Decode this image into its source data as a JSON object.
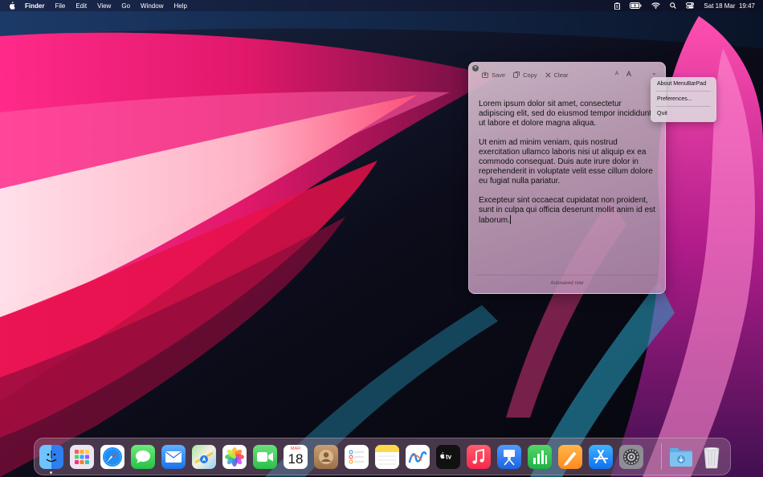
{
  "menubar": {
    "apple_icon": "apple-logo-icon",
    "app_name": "Finder",
    "menus": [
      "File",
      "Edit",
      "View",
      "Go",
      "Window",
      "Help"
    ],
    "status_icons": [
      "clipboard-icon",
      "battery-charging-icon",
      "wifi-icon",
      "spotlight-search-icon",
      "control-center-icon"
    ],
    "datetime": "Sat 18 Mar  19:47"
  },
  "note_window": {
    "toolbar": {
      "save_label": "Save",
      "copy_label": "Copy",
      "clear_label": "Clear",
      "font_small": "A",
      "font_large": "A",
      "menu_chevron": "⌄"
    },
    "paragraphs": [
      "Lorem ipsum dolor sit amet, consectetur adipiscing elit, sed do eiusmod tempor incididunt ut labore et dolore magna aliqua.",
      "Ut enim ad minim veniam, quis nostrud exercitation ullamco laboris nisi ut aliquip ex ea commodo consequat. Duis aute irure dolor in reprehenderit in voluptate velit esse cillum dolore eu fugiat nulla pariatur.",
      "Excepteur sint occaecat cupidatat non proident, sunt in culpa qui officia deserunt mollit anim id est laborum."
    ],
    "status": "Autosaved now"
  },
  "dropdown_menu": {
    "items": [
      "About MenuBarPad",
      "Preferences...",
      "Quit"
    ]
  },
  "dock": {
    "calendar": {
      "month": "MAR",
      "day": "18"
    },
    "apps": [
      {
        "name": "Finder",
        "icon": "finder-icon",
        "color": "#3a8ff0"
      },
      {
        "name": "Launchpad",
        "icon": "launchpad-icon",
        "color": "#e9e3ee"
      },
      {
        "name": "Safari",
        "icon": "safari-icon",
        "color": "#2d8cf0"
      },
      {
        "name": "Messages",
        "icon": "messages-icon",
        "color": "#35c759"
      },
      {
        "name": "Mail",
        "icon": "mail-icon",
        "color": "#3a8ef5"
      },
      {
        "name": "Maps",
        "icon": "maps-icon",
        "color": "#6fc46a"
      },
      {
        "name": "Photos",
        "icon": "photos-icon",
        "color": "#ffffff"
      },
      {
        "name": "FaceTime",
        "icon": "facetime-icon",
        "color": "#34c759"
      },
      {
        "name": "Calendar",
        "icon": "calendar-icon",
        "color": "#ffffff"
      },
      {
        "name": "Contacts",
        "icon": "contacts-icon",
        "color": "#b48a60"
      },
      {
        "name": "Reminders",
        "icon": "reminders-icon",
        "color": "#ffffff"
      },
      {
        "name": "Notes",
        "icon": "notes-icon",
        "color": "#ffd84a"
      },
      {
        "name": "Freeform",
        "icon": "freeform-icon",
        "color": "#ffffff"
      },
      {
        "name": "TV",
        "icon": "apple-tv-icon",
        "color": "#111111"
      },
      {
        "name": "Music",
        "icon": "music-icon",
        "color": "#fa3e55"
      },
      {
        "name": "Keynote",
        "icon": "keynote-icon",
        "color": "#2e7cf6"
      },
      {
        "name": "Numbers",
        "icon": "numbers-icon",
        "color": "#2fbf4f"
      },
      {
        "name": "Pages",
        "icon": "pages-icon",
        "color": "#ff9f2e"
      },
      {
        "name": "App Store",
        "icon": "app-store-icon",
        "color": "#1a8cff"
      },
      {
        "name": "System Settings",
        "icon": "system-settings-icon",
        "color": "#8a8a90"
      },
      {
        "name": "Downloads",
        "icon": "downloads-folder-icon",
        "color": "#6bb7f0"
      },
      {
        "name": "Trash",
        "icon": "trash-icon",
        "color": "#d9d9de"
      }
    ]
  }
}
